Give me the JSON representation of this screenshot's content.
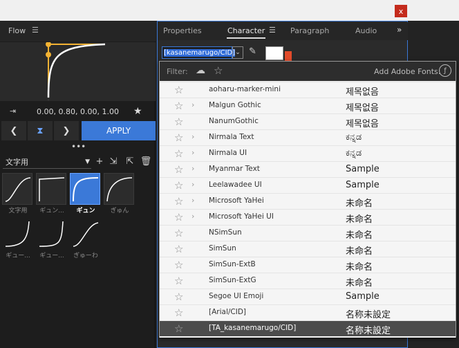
{
  "window": {
    "close_label": "x"
  },
  "flow": {
    "title": "Flow",
    "menu_icon": "hamburger-icon",
    "readout": "0.00, 0.80, 0.00, 1.00",
    "apply_label": "APPLY",
    "more_label": "•••",
    "preset_selected": "文字用",
    "thumbnails": [
      {
        "label": "文字用"
      },
      {
        "label": "ギュン..."
      },
      {
        "label": "ギュン"
      },
      {
        "label": "ぎゅん"
      },
      {
        "label": "ギュー..."
      },
      {
        "label": "ギュー..."
      },
      {
        "label": "ぎゅーわ"
      }
    ]
  },
  "tabs": [
    {
      "label": "Properties"
    },
    {
      "label": "Character"
    },
    {
      "label": "Paragraph"
    },
    {
      "label": "Audio"
    }
  ],
  "character": {
    "font_value": "[kasanemarugo/CID]"
  },
  "font_popup": {
    "filter_label": "Filter:",
    "adobe_fonts_label": "Add Adobe Fonts:",
    "fonts": [
      {
        "name": "aoharu-marker-mini",
        "sample": "제목없음",
        "chevron": false
      },
      {
        "name": "Malgun Gothic",
        "sample": "제목없음",
        "chevron": true
      },
      {
        "name": "NanumGothic",
        "sample": "제목없음",
        "chevron": false
      },
      {
        "name": "Nirmala Text",
        "sample": "ಕನ್ನಡ",
        "chevron": true
      },
      {
        "name": "Nirmala UI",
        "sample": "ಕನ್ನಡ",
        "chevron": true
      },
      {
        "name": "Myanmar Text",
        "sample": "Sample",
        "chevron": true
      },
      {
        "name": "Leelawadee UI",
        "sample": "Sample",
        "chevron": true
      },
      {
        "name": "Microsoft YaHei",
        "sample": "未命名",
        "chevron": true
      },
      {
        "name": "Microsoft YaHei UI",
        "sample": "未命名",
        "chevron": true
      },
      {
        "name": "NSimSun",
        "sample": "未命名",
        "chevron": false
      },
      {
        "name": "SimSun",
        "sample": "未命名",
        "chevron": false
      },
      {
        "name": "SimSun-ExtB",
        "sample": "未命名",
        "chevron": false
      },
      {
        "name": "SimSun-ExtG",
        "sample": "未命名",
        "chevron": false
      },
      {
        "name": "Segoe UI Emoji",
        "sample": "Sample",
        "chevron": false
      },
      {
        "name": "[Arial/CID]",
        "sample": "名称未設定",
        "chevron": false
      },
      {
        "name": "[TA_kasanemarugo/CID]",
        "sample": "名称未設定",
        "chevron": false,
        "highlighted": true
      }
    ]
  }
}
